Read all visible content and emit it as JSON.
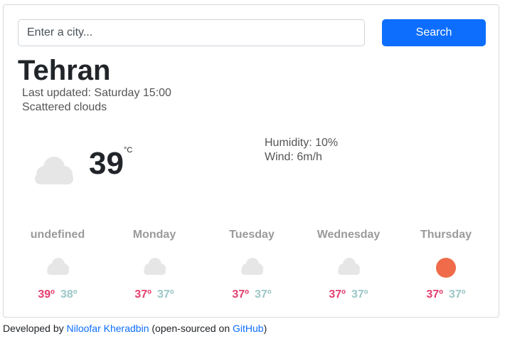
{
  "search": {
    "placeholder": "Enter a city...",
    "value": "",
    "button_label": "Search"
  },
  "current": {
    "city": "Tehran",
    "last_updated": "Last updated: Saturday 15:00",
    "description": "Scattered clouds",
    "temperature": "39",
    "unit": "°C",
    "humidity": "Humidity: 10%",
    "wind": "Wind: 6m/h",
    "icon": "cloud-icon"
  },
  "forecast": [
    {
      "day": "undefined",
      "icon": "cloud-icon",
      "max": "39º",
      "min": "38º"
    },
    {
      "day": "Monday",
      "icon": "cloud-icon",
      "max": "37º",
      "min": "37º"
    },
    {
      "day": "Tuesday",
      "icon": "cloud-icon",
      "max": "37º",
      "min": "37º"
    },
    {
      "day": "Wednesday",
      "icon": "cloud-icon",
      "max": "37º",
      "min": "37º"
    },
    {
      "day": "Thursday",
      "icon": "sun-icon",
      "max": "37º",
      "min": "37º"
    }
  ],
  "footer": {
    "prefix": "Developed by ",
    "author_link": "Niloofar Kheradbin",
    "middle": " (open-sourced on ",
    "github_link": "GitHub",
    "suffix": ")"
  },
  "colors": {
    "accent": "#0d6efd",
    "max_temp": "#e4406f",
    "min_temp": "#9cc7c7",
    "sun": "#ef6b4a",
    "cloud": "#e6e6e6"
  }
}
